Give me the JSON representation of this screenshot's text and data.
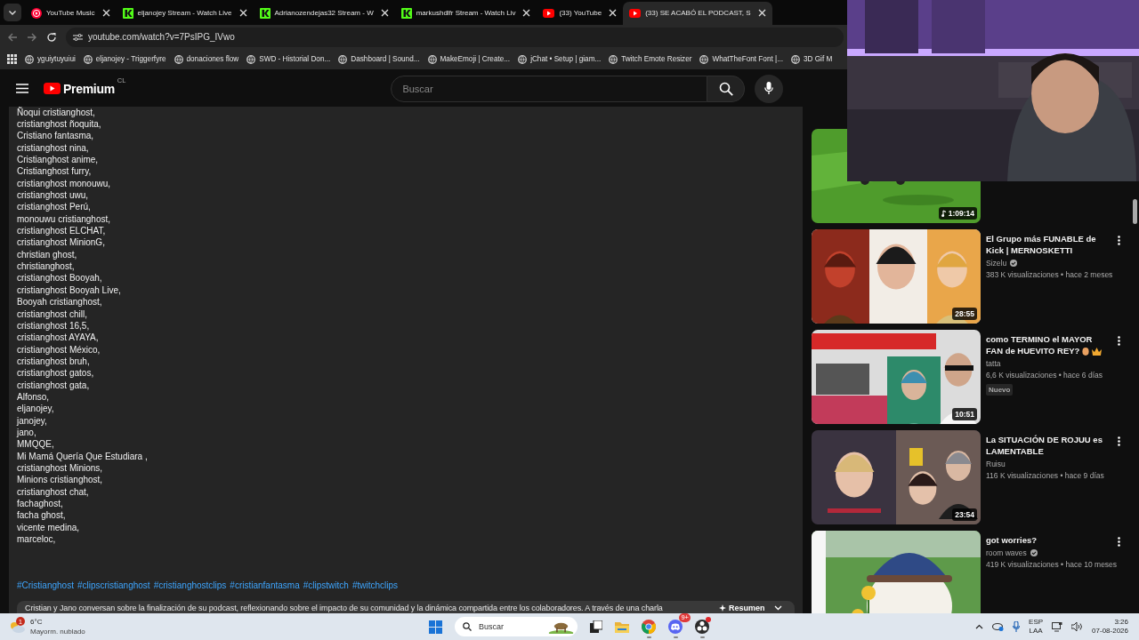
{
  "browser": {
    "tabs": [
      {
        "kind": "youtube-music",
        "title": "YouTube Music",
        "selected": false
      },
      {
        "kind": "kick",
        "title": "eljanojey Stream - Watch Live",
        "selected": false
      },
      {
        "kind": "kick",
        "title": "Adrianozendejas32 Stream - W",
        "selected": false
      },
      {
        "kind": "kick",
        "title": "markushdlfr Stream - Watch Liv",
        "selected": false
      },
      {
        "kind": "youtube",
        "title": "(33) YouTube",
        "selected": false
      },
      {
        "kind": "youtube",
        "title": "(33) SE ACABÓ EL PODCAST, S",
        "selected": true
      }
    ],
    "address": "youtube.com/watch?v=7PsIPG_IVwo",
    "bookmarks": [
      "yguiytuyuiui",
      "eljanojey - Triggerfyre",
      "donaciones flow",
      "SWD - Historial Don...",
      "Dashboard | Sound...",
      "MakeEmoji | Create...",
      "jChat • Setup | giam...",
      "Twitch Emote Resizer",
      "WhatTheFont Font |...",
      "3D Gif M"
    ]
  },
  "header": {
    "logo": "Premium",
    "region": "CL",
    "search_placeholder": "Buscar"
  },
  "description": {
    "lines": [
      "Ñoqui cristianghost,",
      "cristianghost ñoquita,",
      "Cristiano fantasma,",
      "cristianghost nina,",
      "Cristianghost anime,",
      "Cristianghost furry,",
      "cristianghost monouwu,",
      "cristianghost uwu,",
      "cristianghost Perú,",
      "monouwu cristianghost,",
      "cristianghost ELCHAT,",
      "cristianghost MinionG,",
      "christian ghost,",
      "christianghost,",
      "cristianghost Booyah,",
      "cristianghost Booyah Live,",
      "Booyah cristianghost,",
      "cristianghost chill,",
      "cristianghost 16,5,",
      "cristianghost AYAYA,",
      "cristianghost México,",
      "cristianghost bruh,",
      "cristianghost gatos,",
      "cristianghost gata,",
      "Alfonso,",
      "eljanojey,",
      "janojey,",
      "jano,",
      "MMQQE,",
      "Mi Mamá Quería Que Estudiara ,",
      "cristianghost Minions,",
      "Minions cristianghost,",
      "cristianghost chat,",
      "fachaghost,",
      "facha ghost,",
      "vicente medina,",
      "marceloc,"
    ],
    "hashtags": [
      "#Cristianghost",
      "#clipscristianghost",
      "#cristianghostclips",
      "#cristianfantasma",
      "#clipstwitch",
      "#twitchclips"
    ],
    "summary": "Cristian y Jano conversan sobre la finalización de su podcast, reflexionando sobre el impacto de su comunidad y la dinámica compartida entre los colaboradores. A través de una charla",
    "summary_button": "Resumen"
  },
  "sidebar": {
    "videos": [
      {
        "duration": "1:09:14",
        "music": true
      },
      {
        "title": "El Grupo más FUNABLE de Kick | MERNOSKETTI",
        "channel": "Sizelu",
        "verified": true,
        "meta": "383 K visualizaciones • hace 2 meses",
        "duration": "28:55"
      },
      {
        "title": "como TERMINO el MAYOR FAN de HUEVITO REY?",
        "emojis": [
          {
            "kind": "egg"
          },
          {
            "kind": "crown"
          }
        ],
        "channel": "tatta",
        "meta": "6,6 K visualizaciones • hace 6 días",
        "badge": "Nuevo",
        "duration": "10:51"
      },
      {
        "title": "La SITUACIÓN DE ROJUU es LAMENTABLE",
        "channel": "Ruisu",
        "meta": "116 K visualizaciones • hace 9 días",
        "duration": "23:54"
      },
      {
        "title": "got worries?",
        "channel": "room waves",
        "verified": true,
        "meta": "419 K visualizaciones • hace 10 meses"
      }
    ]
  },
  "taskbar": {
    "weather": {
      "temp": "6°C",
      "condition": "Mayorm. nublado",
      "alerts": "1"
    },
    "search_placeholder": "Buscar",
    "apps": [
      {
        "kind": "task-view",
        "running": false
      },
      {
        "kind": "folder",
        "running": false
      },
      {
        "kind": "chrome",
        "running": true
      },
      {
        "kind": "discord",
        "running": true,
        "badge": "9+"
      },
      {
        "kind": "obs",
        "running": true,
        "alert": true
      }
    ],
    "language": [
      "ESP",
      "LAA"
    ],
    "time": "3:26",
    "date": "07-08-2026"
  }
}
